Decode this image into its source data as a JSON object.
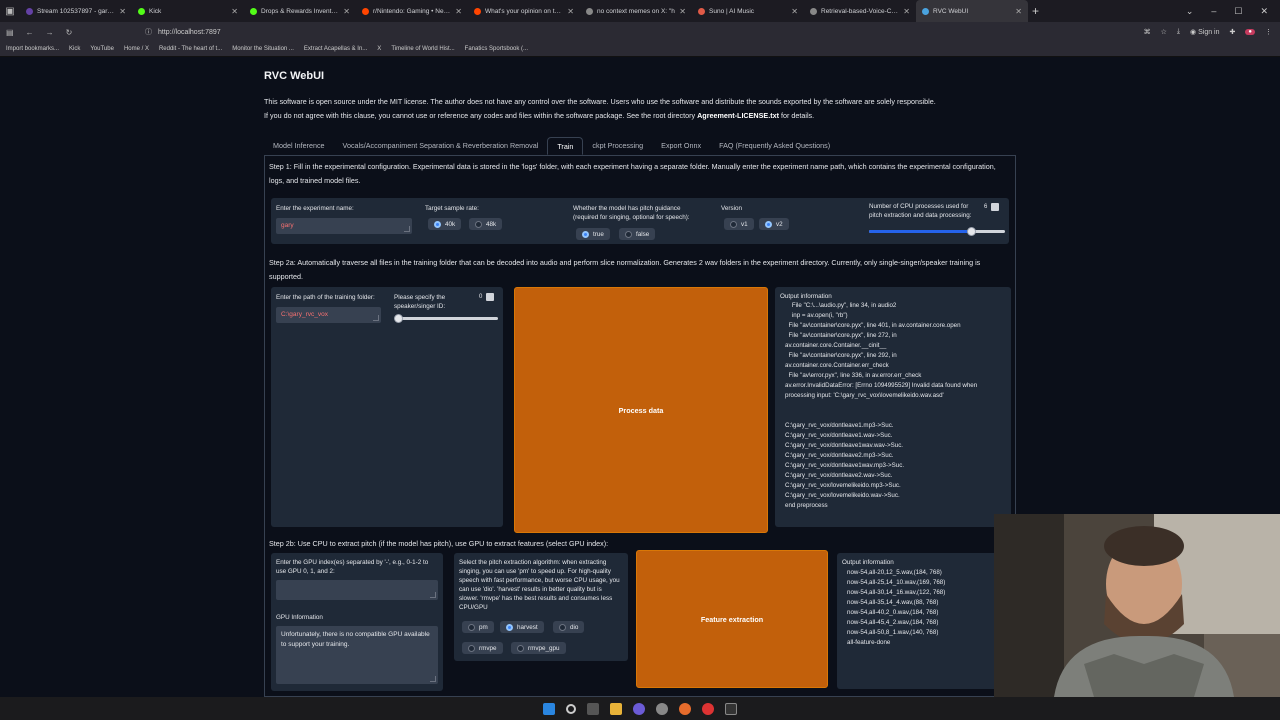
{
  "browser": {
    "tabs": [
      {
        "title": "Stream 102537897 - garydavid",
        "color": "#6441a5"
      },
      {
        "title": "Kick",
        "color": "#53fc18"
      },
      {
        "title": "Drops & Rewards Inventory - K",
        "color": "#53fc18"
      },
      {
        "title": "r/Nintendo: Gaming • News • D",
        "color": "#ff4500"
      },
      {
        "title": "What's your opinion on the Na",
        "color": "#ff4500"
      },
      {
        "title": "no context memes on X: \"h",
        "color": "#888888"
      },
      {
        "title": "Suno | AI Music",
        "color": "#e05a47"
      },
      {
        "title": "Retrieval-based-Voice-Conve",
        "color": "#888888"
      },
      {
        "title": "RVC WebUI",
        "color": "#4aa3df"
      }
    ],
    "url": "http://localhost:7897",
    "sign_in": "Sign in",
    "bookmarks": [
      "Import bookmarks...",
      "Kick",
      "YouTube",
      "Home / X",
      "Reddit - The heart of t...",
      "Monitor the Situation ...",
      "Extract Acapellas & In...",
      "X",
      "Timeline of World Hist...",
      "Fanatics Sportsbook (..."
    ]
  },
  "app": {
    "title": "RVC WebUI",
    "license_line1": "This software is open source under the MIT license. The author does not have any control over the software. Users who use the software and distribute the sounds exported by the software are solely responsible.",
    "license_line2_pre": "If you do not agree with this clause, you cannot use or reference any codes and files within the software package. See the root directory ",
    "license_file": "Agreement-LICENSE.txt",
    "license_line2_post": " for details.",
    "tabs": [
      "Model Inference",
      "Vocals/Accompaniment Separation & Reverberation Removal",
      "Train",
      "ckpt Processing",
      "Export Onnx",
      "FAQ (Frequently Asked Questions)"
    ],
    "active_tab": "Train"
  },
  "step1": {
    "text": "Step 1: Fill in the experimental configuration. Experimental data is stored in the 'logs' folder, with each experiment having a separate folder. Manually enter the experiment name path, which contains the experimental configuration, logs, and trained model files.",
    "exp_name_label": "Enter the experiment name:",
    "exp_name_value": "gary",
    "sample_rate_label": "Target sample rate:",
    "sample_rates": [
      "40k",
      "48k"
    ],
    "sample_rate_selected": "40k",
    "pitch_label": "Whether the model has pitch guidance (required for singing, optional for speech):",
    "pitch_options": [
      "true",
      "false"
    ],
    "pitch_selected": "true",
    "version_label": "Version",
    "versions": [
      "v1",
      "v2"
    ],
    "version_selected": "v2",
    "cpu_label": "Number of CPU processes used for pitch extraction and data processing:",
    "cpu_value": "6",
    "cpu_fraction": 0.75
  },
  "step2a": {
    "text": "Step 2a: Automatically traverse all files in the training folder that can be decoded into audio and perform slice normalization. Generates 2 wav folders in the experiment directory. Currently, only single-singer/speaker training is supported.",
    "folder_label": "Enter the path of the training folder:",
    "folder_value": "C:\\gary_rvc_vox",
    "speaker_label": "Please specify the speaker/singer ID:",
    "speaker_value": "0",
    "speaker_fraction": 0.0,
    "process_button": "Process data",
    "output_label": "Output information",
    "output_text": "    File \"C:\\...\\audio.py\", line 34, in audio2\n    inp = av.open(i, \"rb\")\n  File \"av\\container\\core.pyx\", line 401, in av.container.core.open\n  File \"av\\container\\core.pyx\", line 272, in\nav.container.core.Container.__cinit__\n  File \"av\\container\\core.pyx\", line 292, in\nav.container.core.Container.err_check\n  File \"av\\error.pyx\", line 336, in av.error.err_check\nav.error.InvalidDataError: [Errno 1094995529] Invalid data found when\nprocessing input: 'C:\\gary_rvc_vox\\lovemelikeido.wav.asd'\n\n\nC:\\gary_rvc_vox/dontleave1.mp3->Suc.\nC:\\gary_rvc_vox/dontleave1.wav->Suc.\nC:\\gary_rvc_vox/dontleave1wav.wav->Suc.\nC:\\gary_rvc_vox/dontleave2.mp3->Suc.\nC:\\gary_rvc_vox/dontleave1wav.mp3->Suc.\nC:\\gary_rvc_vox/dontleave2.wav->Suc.\nC:\\gary_rvc_vox/lovemelikeido.mp3->Suc.\nC:\\gary_rvc_vox/lovemelikeido.wav->Suc.\nend preprocess"
  },
  "step2b": {
    "text": "Step 2b: Use CPU to extract pitch (if the model has pitch), use GPU to extract features (select GPU index):",
    "gpu_index_label": "Enter the GPU index(es) separated by '-', e.g., 0-1-2 to use GPU 0, 1, and 2:",
    "gpu_info_label": "GPU Information",
    "gpu_info_value": "Unfortunately, there is no compatible GPU available to support your training.",
    "algo_label": "Select the pitch extraction algorithm: when extracting singing, you can use 'pm' to speed up. For high-quality speech with fast performance, but worse CPU usage, you can use 'dio'. 'harvest' results in better quality but is slower. 'rmvpe' has the best results and consumes less CPU/GPU",
    "algos": [
      "pm",
      "harvest",
      "dio",
      "rmvpe",
      "rmvpe_gpu"
    ],
    "algo_selected": "harvest",
    "feature_button": "Feature extraction",
    "output_label": "Output information",
    "output_text": "now-54,all-20,12_5.wav,(184, 768)\nnow-54,all-25,14_10.wav,(169, 768)\nnow-54,all-30,14_16.wav,(122, 768)\nnow-54,all-35,14_4.wav,(88, 768)\nnow-54,all-40,2_0.wav,(184, 768)\nnow-54,all-45,4_2.wav,(184, 768)\nnow-54,all-50,8_1.wav,(140, 768)\nall-feature-done"
  }
}
